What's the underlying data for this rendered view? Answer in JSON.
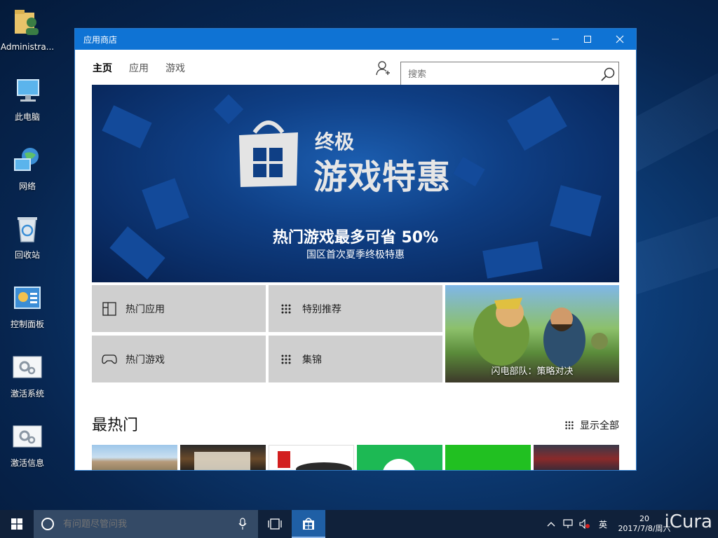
{
  "desktop": {
    "icons": [
      {
        "label": "Administra..."
      },
      {
        "label": "此电脑"
      },
      {
        "label": "网络"
      },
      {
        "label": "回收站"
      },
      {
        "label": "控制面板"
      },
      {
        "label": "激活系统"
      },
      {
        "label": "激活信息"
      }
    ]
  },
  "window": {
    "title": "应用商店",
    "nav": {
      "tabs": [
        {
          "label": "主页"
        },
        {
          "label": "应用"
        },
        {
          "label": "游戏"
        }
      ],
      "search_placeholder": "搜索"
    },
    "hero": {
      "line1": "终极",
      "line2": "游戏特惠",
      "headline": "热门游戏最多可省 50%",
      "subline": "国区首次夏季终极特惠"
    },
    "tiles": [
      {
        "label": "热门应用",
        "icon": "apps-grid-icon"
      },
      {
        "label": "特别推荐",
        "icon": "dots-grid-icon"
      },
      {
        "label": "热门游戏",
        "icon": "gamepad-icon"
      },
      {
        "label": "集锦",
        "icon": "dots-grid-icon"
      }
    ],
    "promo_label": "闪电部队：策略对决",
    "section": {
      "title": "最热门",
      "show_all": "显示全部"
    }
  },
  "taskbar": {
    "search_placeholder": "有问题尽管问我",
    "ime": "英",
    "clock_top": "20",
    "clock_bottom": "2017/7/8/周六",
    "watermark": "iCura"
  },
  "colors": {
    "titlebar": "#0f73d4",
    "tile": "#cfcfcf",
    "taskbar": "#10213a"
  }
}
